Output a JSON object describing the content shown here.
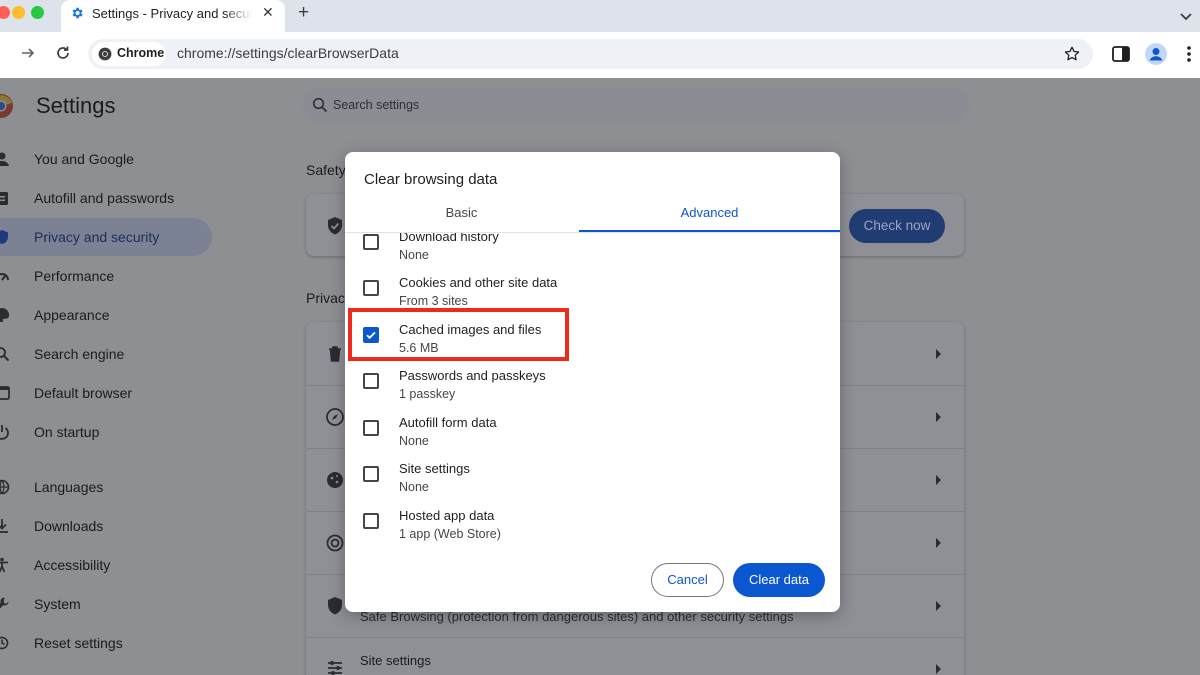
{
  "browser": {
    "tab_title": "Settings - Privacy and security",
    "tab_close": "✕",
    "new_tab": "+",
    "site_chip": "Chrome",
    "url": "chrome://settings/clearBrowserData"
  },
  "settings": {
    "title": "Settings",
    "search_placeholder": "Search settings",
    "nav": [
      {
        "label": "You and Google",
        "icon": "person-icon"
      },
      {
        "label": "Autofill and passwords",
        "icon": "clipboard-icon"
      },
      {
        "label": "Privacy and security",
        "icon": "shield-icon",
        "active": true
      },
      {
        "label": "Performance",
        "icon": "gauge-icon"
      },
      {
        "label": "Appearance",
        "icon": "palette-icon"
      },
      {
        "label": "Search engine",
        "icon": "search-icon"
      },
      {
        "label": "Default browser",
        "icon": "browser-icon"
      },
      {
        "label": "On startup",
        "icon": "power-icon"
      },
      {
        "label": "Languages",
        "icon": "globe-icon"
      },
      {
        "label": "Downloads",
        "icon": "download-icon"
      },
      {
        "label": "Accessibility",
        "icon": "accessibility-icon"
      },
      {
        "label": "System",
        "icon": "wrench-icon"
      },
      {
        "label": "Reset settings",
        "icon": "history-icon"
      }
    ],
    "section_safety": "Safety",
    "section_privacy": "Privacy",
    "check_now": "Check now",
    "bg_safe_browsing_text": "Safe Browsing (protection from dangerous sites) and other security settings",
    "bg_site_settings": "Site settings"
  },
  "dialog": {
    "title": "Clear browsing data",
    "tabs": {
      "basic": "Basic",
      "advanced": "Advanced"
    },
    "items": [
      {
        "title": "Download history",
        "sub": "None",
        "checked": false
      },
      {
        "title": "Cookies and other site data",
        "sub": "From 3 sites",
        "checked": false
      },
      {
        "title": "Cached images and files",
        "sub": "5.6 MB",
        "checked": true
      },
      {
        "title": "Passwords and passkeys",
        "sub": "1 passkey",
        "checked": false
      },
      {
        "title": "Autofill form data",
        "sub": "None",
        "checked": false
      },
      {
        "title": "Site settings",
        "sub": "None",
        "checked": false
      },
      {
        "title": "Hosted app data",
        "sub": "1 app (Web Store)",
        "checked": false
      }
    ],
    "cancel": "Cancel",
    "clear": "Clear data"
  },
  "colors": {
    "accent": "#0b57d0",
    "highlight": "#ee2b1b"
  }
}
